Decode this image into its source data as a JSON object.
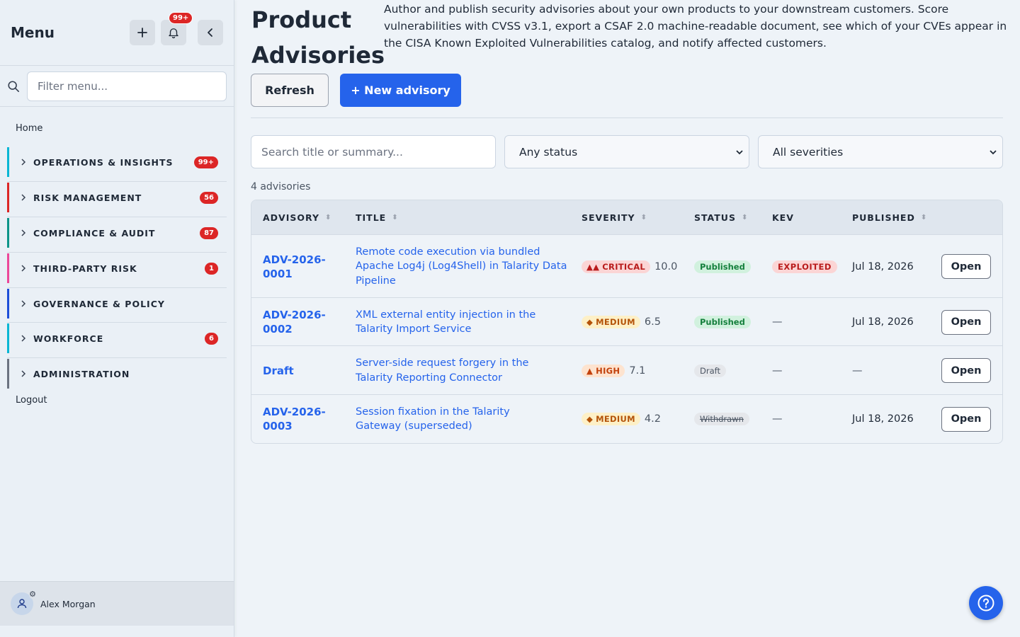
{
  "sidebar": {
    "title": "Menu",
    "notification_count": "99+",
    "filter_placeholder": "Filter menu...",
    "home": "Home",
    "logout": "Logout",
    "groups": [
      {
        "label": "OPERATIONS & INSIGHTS",
        "badge": "99+",
        "color": "#06b6d4"
      },
      {
        "label": "RISK MANAGEMENT",
        "badge": "56",
        "color": "#dc2626"
      },
      {
        "label": "COMPLIANCE & AUDIT",
        "badge": "87",
        "color": "#0d9488"
      },
      {
        "label": "THIRD-PARTY RISK",
        "badge": "1",
        "color": "#ec4899"
      },
      {
        "label": "GOVERNANCE & POLICY",
        "badge": "",
        "color": "#1d4ed8"
      },
      {
        "label": "WORKFORCE",
        "badge": "6",
        "color": "#06b6d4"
      },
      {
        "label": "ADMINISTRATION",
        "badge": "",
        "color": "#6b7280"
      }
    ],
    "user_name": "Alex Morgan"
  },
  "header": {
    "title": "Product Advisories",
    "description": "Author and publish security advisories about your own products to your downstream customers. Score vulnerabilities with CVSS v3.1, export a CSAF 2.0 machine-readable document, see which of your CVEs appear in the CISA Known Exploited Vulnerabilities catalog, and notify affected customers."
  },
  "actions": {
    "refresh": "Refresh",
    "new_advisory": "+ New advisory"
  },
  "filters": {
    "search_placeholder": "Search title or summary...",
    "status_selected": "Any status",
    "severity_selected": "All severities"
  },
  "count_text": "4 advisories",
  "table": {
    "columns": [
      "ADVISORY",
      "TITLE",
      "SEVERITY",
      "STATUS",
      "KEV",
      "PUBLISHED"
    ],
    "rows": [
      {
        "id": "ADV-2026-0001",
        "title": "Remote code execution via bundled Apache Log4j (Log4Shell) in Talarity Data Pipeline",
        "severity": "CRITICAL",
        "severity_icon": "▲▲",
        "score": "10.0",
        "status": "Published",
        "kev": "EXPLOITED",
        "published": "Jul 18, 2026",
        "action": "Open"
      },
      {
        "id": "ADV-2026-0002",
        "title": "XML external entity injection in the Talarity Import Service",
        "severity": "MEDIUM",
        "severity_icon": "◆",
        "score": "6.5",
        "status": "Published",
        "kev": "—",
        "published": "Jul 18, 2026",
        "action": "Open"
      },
      {
        "id": "Draft",
        "title": "Server-side request forgery in the Talarity Reporting Connector",
        "severity": "HIGH",
        "severity_icon": "▲",
        "score": "7.1",
        "status": "Draft",
        "kev": "—",
        "published": "—",
        "action": "Open"
      },
      {
        "id": "ADV-2026-0003",
        "title": "Session fixation in the Talarity Gateway (superseded)",
        "severity": "MEDIUM",
        "severity_icon": "◆",
        "score": "4.2",
        "status": "Withdrawn",
        "kev": "—",
        "published": "Jul 18, 2026",
        "action": "Open"
      }
    ]
  },
  "colors": {
    "accent": "#2563eb",
    "danger": "#dc2626",
    "success": "#15803d"
  }
}
